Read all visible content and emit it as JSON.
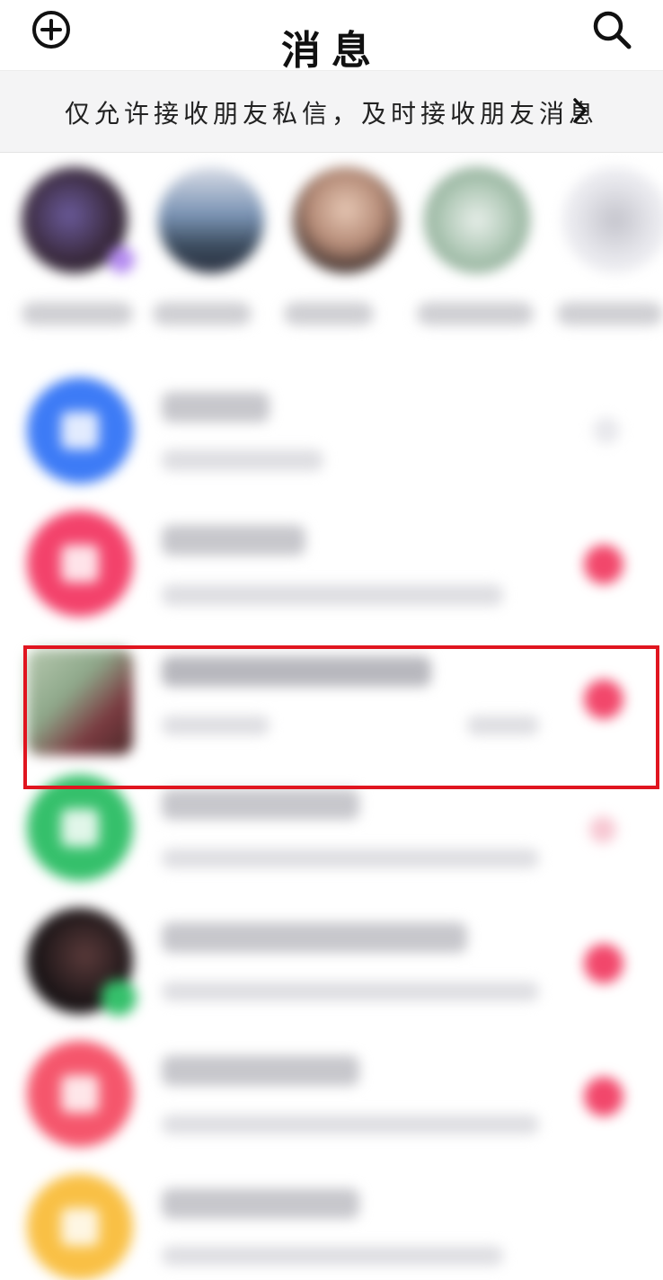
{
  "header": {
    "title": "消息",
    "left_icon": "plus-circle-icon",
    "right_icon": "search-icon"
  },
  "banner": {
    "text": "仅允许接收朋友私信，及时接收朋友消息",
    "chevron_icon": "chevron-right-icon"
  },
  "colors": {
    "highlight_border": "#e0151f",
    "badge": "#f2476b"
  },
  "stories": [
    {
      "avatar": "avatar-1"
    },
    {
      "avatar": "avatar-2"
    },
    {
      "avatar": "avatar-3"
    },
    {
      "avatar": "avatar-4"
    },
    {
      "avatar": "avatar-5"
    }
  ],
  "conversations": [
    {
      "avatar_color": "#3d7bf6",
      "unread": false
    },
    {
      "avatar_color": "#f3426b",
      "unread": true
    },
    {
      "avatar_color": "photo",
      "unread": true,
      "highlighted": true
    },
    {
      "avatar_color": "#35c06b",
      "unread": false
    },
    {
      "avatar_color": "photo-dark",
      "unread": true
    },
    {
      "avatar_color": "#f5566c",
      "unread": true
    },
    {
      "avatar_color": "#f9c045",
      "unread": false
    }
  ]
}
